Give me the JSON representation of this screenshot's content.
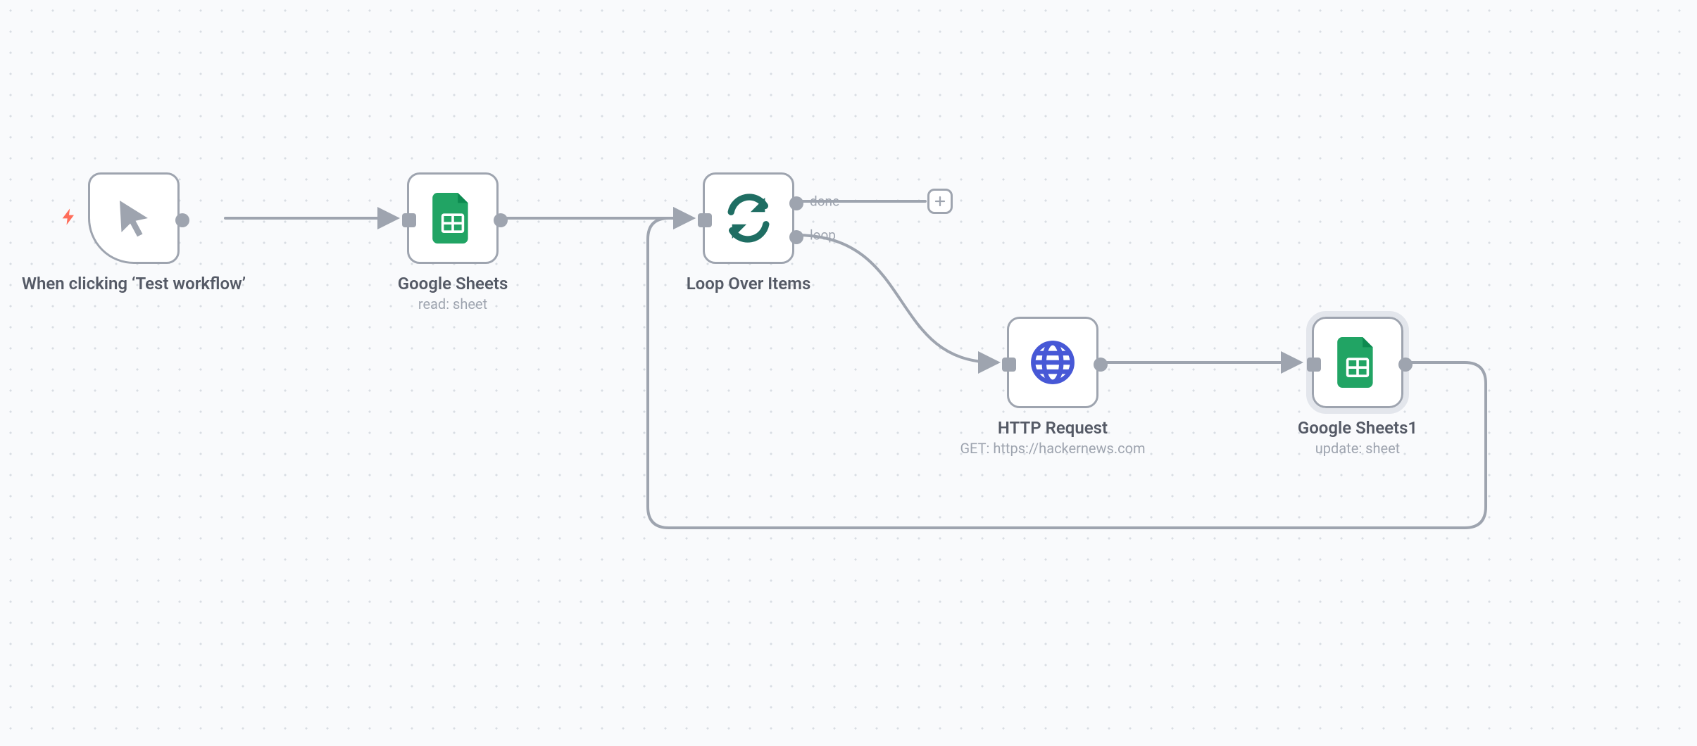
{
  "nodes": {
    "trigger": {
      "title": "When clicking ‘Test workflow’",
      "sub": ""
    },
    "sheets_read": {
      "title": "Google Sheets",
      "sub": "read: sheet"
    },
    "loop": {
      "title": "Loop Over Items",
      "sub": "",
      "out_done_label": "done",
      "out_loop_label": "loop"
    },
    "http": {
      "title": "HTTP Request",
      "sub": "GET: https://hackernews.com"
    },
    "sheets_update": {
      "title": "Google Sheets1",
      "sub": "update: sheet"
    }
  },
  "colors": {
    "node_border": "#9ea4af",
    "bolt": "#ff6d5a",
    "sheets_green": "#21a464",
    "loop_teal": "#1f6e63",
    "http_blue": "#4758d6",
    "selection_ring": "#e3e6ec"
  }
}
